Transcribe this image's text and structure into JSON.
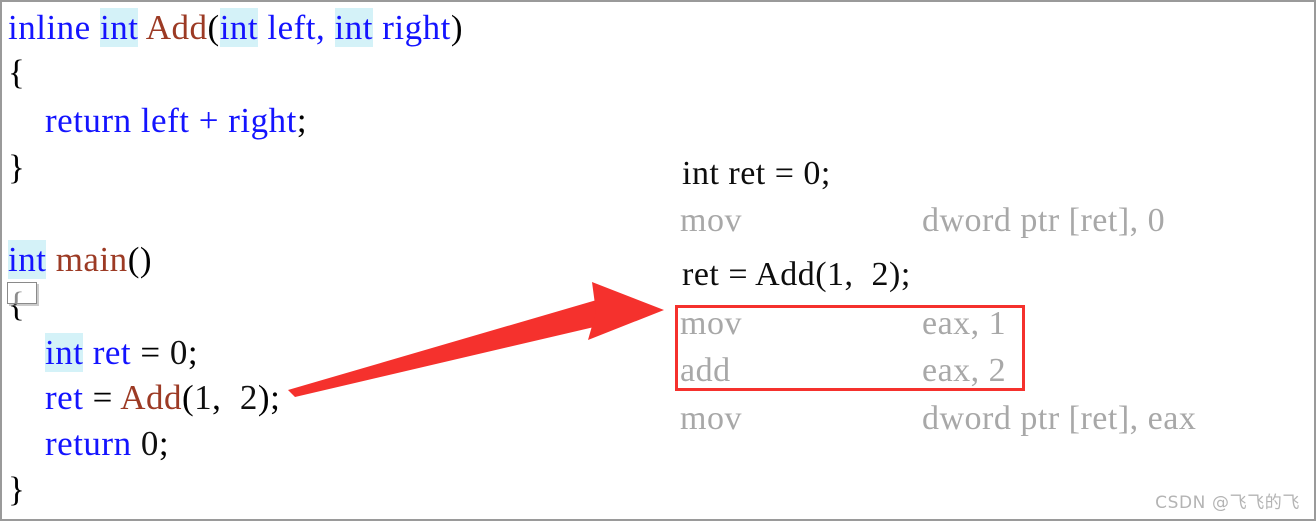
{
  "source_pane": {
    "lines": [
      {
        "id": "src-line-1",
        "tokens": [
          {
            "t": "inline ",
            "c": "kw"
          },
          {
            "t": "int",
            "c": "kw-hl"
          },
          {
            "t": " ",
            "c": "plain"
          },
          {
            "t": "Add",
            "c": "fn"
          },
          {
            "t": "(",
            "c": "plain"
          },
          {
            "t": "int",
            "c": "kw-hl"
          },
          {
            "t": " left, ",
            "c": "kw"
          },
          {
            "t": "int",
            "c": "kw-hl"
          },
          {
            "t": " right",
            "c": "kw"
          },
          {
            "t": ")",
            "c": "plain"
          }
        ]
      },
      {
        "id": "src-line-2",
        "tokens": [
          {
            "t": "{",
            "c": "plain"
          }
        ]
      },
      {
        "id": "src-line-3",
        "tokens": [
          {
            "t": "    ",
            "c": "plain"
          },
          {
            "t": "return",
            "c": "kw"
          },
          {
            "t": " ",
            "c": "plain"
          },
          {
            "t": "left",
            "c": "kw"
          },
          {
            "t": " ",
            "c": "plain"
          },
          {
            "t": "+",
            "c": "kw"
          },
          {
            "t": " ",
            "c": "plain"
          },
          {
            "t": "right",
            "c": "kw"
          },
          {
            "t": ";",
            "c": "plain"
          }
        ]
      },
      {
        "id": "src-line-4",
        "tokens": [
          {
            "t": "}",
            "c": "plain"
          }
        ]
      },
      {
        "id": "src-line-5",
        "tokens": [
          {
            "t": "int",
            "c": "kw-hl"
          },
          {
            "t": " ",
            "c": "plain"
          },
          {
            "t": "main",
            "c": "fn"
          },
          {
            "t": "()",
            "c": "plain"
          }
        ]
      },
      {
        "id": "src-line-6",
        "tokens": [
          {
            "t": "{",
            "c": "plain"
          }
        ]
      },
      {
        "id": "src-line-7",
        "tokens": [
          {
            "t": "    ",
            "c": "plain"
          },
          {
            "t": "int",
            "c": "kw-hl"
          },
          {
            "t": " ",
            "c": "plain"
          },
          {
            "t": "ret",
            "c": "kw"
          },
          {
            "t": " = ",
            "c": "plain"
          },
          {
            "t": "0",
            "c": "num"
          },
          {
            "t": ";",
            "c": "plain"
          }
        ]
      },
      {
        "id": "src-line-8",
        "tokens": [
          {
            "t": "    ",
            "c": "plain"
          },
          {
            "t": "ret",
            "c": "kw"
          },
          {
            "t": " = ",
            "c": "plain"
          },
          {
            "t": "Add",
            "c": "fn"
          },
          {
            "t": "(",
            "c": "plain"
          },
          {
            "t": "1",
            "c": "num"
          },
          {
            "t": ",  ",
            "c": "plain"
          },
          {
            "t": "2",
            "c": "num"
          },
          {
            "t": ");",
            "c": "plain"
          }
        ]
      },
      {
        "id": "src-line-9",
        "tokens": [
          {
            "t": "    ",
            "c": "plain"
          },
          {
            "t": "return",
            "c": "kw"
          },
          {
            "t": " ",
            "c": "plain"
          },
          {
            "t": "0",
            "c": "num"
          },
          {
            "t": ";",
            "c": "plain"
          }
        ]
      },
      {
        "id": "src-line-10",
        "tokens": [
          {
            "t": "}",
            "c": "plain"
          }
        ]
      }
    ],
    "plain_text": [
      "inline int Add(int left, int right)",
      "{",
      "    return left + right;",
      "}",
      "int main()",
      "{",
      "    int ret = 0;",
      "    ret = Add(1,  2);",
      "    return 0;",
      "}"
    ]
  },
  "disassembly_pane": {
    "rows": [
      {
        "id": "asm-row-0",
        "kind": "source",
        "text": "int ret = 0;"
      },
      {
        "id": "asm-row-1",
        "kind": "instruction",
        "mnemonic": "mov",
        "operands": "dword ptr [ret], 0"
      },
      {
        "id": "asm-row-2",
        "kind": "source",
        "text": "ret = Add(1,  2);"
      },
      {
        "id": "asm-row-3",
        "kind": "instruction",
        "mnemonic": "mov",
        "operands": "eax, 1"
      },
      {
        "id": "asm-row-4",
        "kind": "instruction",
        "mnemonic": "add",
        "operands": "eax, 2"
      },
      {
        "id": "asm-row-5",
        "kind": "instruction",
        "mnemonic": "mov",
        "operands": "dword ptr [ret], eax"
      }
    ]
  },
  "annotations": {
    "highlight_box": {
      "name": "inlined-call-highlight",
      "color": "#f5312d"
    },
    "arrow": {
      "name": "inline-expansion-arrow",
      "color": "#f5312d"
    }
  },
  "watermark": {
    "text": "CSDN @飞飞的飞",
    "color": "#b4b4b4"
  },
  "colors": {
    "keyword_blue": "#1414ff",
    "function_maroon": "#9c3a24",
    "keyword_highlight_bg": "#d4f2f8",
    "instruction_gray": "#a8a8a8",
    "source_black": "#0d0d0d",
    "annotation_red": "#f5312d",
    "page_border": "#9a9a9a"
  }
}
